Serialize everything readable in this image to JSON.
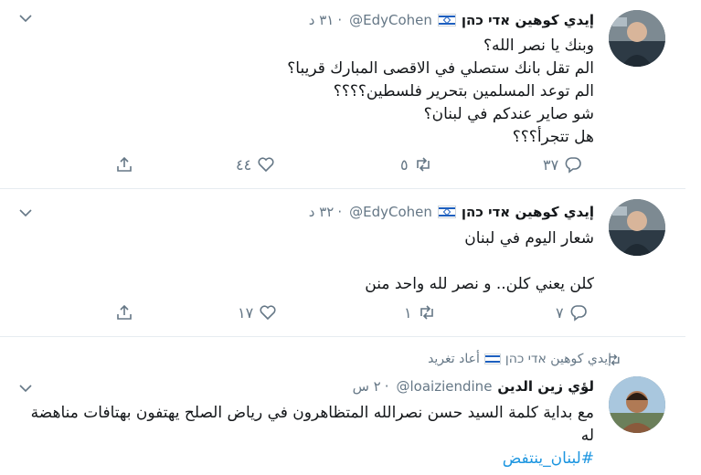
{
  "tweets": [
    {
      "name": "إيدي كوهين אדי כהן",
      "handle": "@EdyCohen",
      "time": "٣١ د",
      "lines": [
        "وبنك يا نصر الله؟",
        "الم تقل بانك ستصلي في الاقصى المبارك قريبا؟",
        "الم توعد المسلمين بتحرير فلسطين؟؟؟؟",
        "شو صاير عندكم في لبنان؟",
        "هل تتجرأ؟؟؟"
      ],
      "replies": "٣٧",
      "retweets": "٥",
      "likes": "٤٤"
    },
    {
      "name": "إيدي كوهين אדי כהן",
      "handle": "@EdyCohen",
      "time": "٣٢ د",
      "lines": [
        "شعار اليوم في لبنان",
        "",
        "كلن يعني كلن.. و نصر لله واحد منن"
      ],
      "replies": "٧",
      "retweets": "١",
      "likes": "١٧"
    },
    {
      "retweeted_by": "إيدي كوهين אדי כהן",
      "retweeted_label": "أعاد تغريد",
      "name": "لؤي زين الدين",
      "handle": "@loaiziendine",
      "time": "٢ س",
      "lines": [
        "مع بداية كلمة السيد حسن نصرالله المتظاهرون في رياض الصلح يهتفون بهتافات مناهضة له"
      ],
      "hashtag": "#لبنان_ينتفض"
    }
  ],
  "icons": {
    "reply": "reply-icon",
    "retweet": "retweet-icon",
    "like": "heart-icon",
    "share": "share-icon",
    "more": "chevron-down-icon"
  },
  "colors": {
    "muted": "#657786",
    "link": "#1b95e0",
    "divider": "#e6ecf0"
  }
}
